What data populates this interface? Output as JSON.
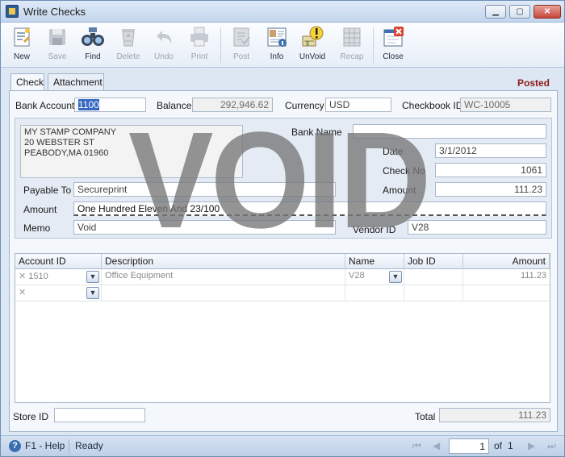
{
  "window": {
    "title": "Write Checks"
  },
  "toolbar": {
    "buttons": [
      {
        "label": "New",
        "icon": "new-document-icon",
        "enabled": true
      },
      {
        "label": "Save",
        "icon": "save-disk-icon",
        "enabled": false
      },
      {
        "label": "Find",
        "icon": "binoculars-icon",
        "enabled": true
      },
      {
        "label": "Delete",
        "icon": "recycle-bin-icon",
        "enabled": false
      },
      {
        "label": "Undo",
        "icon": "undo-arrow-icon",
        "enabled": false
      },
      {
        "label": "Print",
        "icon": "printer-icon",
        "enabled": false
      },
      {
        "label": "Post",
        "icon": "post-ledger-icon",
        "enabled": false
      },
      {
        "label": "Info",
        "icon": "info-icon",
        "enabled": true
      },
      {
        "label": "UnVoid",
        "icon": "unvoid-icon",
        "enabled": true
      },
      {
        "label": "Recap",
        "icon": "recap-icon",
        "enabled": false
      },
      {
        "label": "Close",
        "icon": "close-window-icon",
        "enabled": true
      }
    ]
  },
  "tabs": [
    {
      "label": "Check",
      "active": true
    },
    {
      "label": "Attachment",
      "active": false
    }
  ],
  "status_badge": "Posted",
  "header": {
    "bank_account_label": "Bank Account",
    "bank_account_value": "1100",
    "balance_label": "Balance",
    "balance_value": "292,946.62",
    "currency_label": "Currency",
    "currency_value": "USD",
    "checkbook_label": "Checkbook ID",
    "checkbook_value": "WC-10005"
  },
  "check": {
    "address_lines": [
      "MY STAMP COMPANY",
      "20 WEBSTER ST",
      "PEABODY,MA 01960"
    ],
    "bank_name_label": "Bank Name",
    "bank_name_value": "",
    "date_label": "Date",
    "date_value": "3/1/2012",
    "check_no_label": "Check No",
    "check_no_value": "1061",
    "payable_label": "Payable To",
    "payable_value": "Secureprint",
    "amount_label_right": "Amount",
    "amount_value": "111.23",
    "amount_label_left": "Amount",
    "amount_words": "One Hundred Eleven And 23/100",
    "memo_label": "Memo",
    "memo_value": "Void",
    "vendor_label": "Vendor ID",
    "vendor_value": "V28",
    "void_text": "VOID"
  },
  "grid": {
    "columns": [
      "Account ID",
      "Description",
      "Name",
      "Job ID",
      "Amount"
    ],
    "rows": [
      {
        "account_id": "1510",
        "description": "Office Equipment",
        "name": "V28",
        "job_id": "",
        "amount": "111.23"
      },
      {
        "account_id": "",
        "description": "",
        "name": "",
        "job_id": "",
        "amount": ""
      }
    ]
  },
  "footer": {
    "store_label": "Store ID",
    "store_value": "",
    "total_label": "Total",
    "total_value": "111.23"
  },
  "statusbar": {
    "help": "F1 - Help",
    "status": "Ready",
    "page": "1",
    "of_label": "of",
    "total_pages": "1"
  },
  "colors": {
    "posted": "#8b1b1b",
    "void_watermark": "#777777",
    "selection": "#3468c2"
  }
}
